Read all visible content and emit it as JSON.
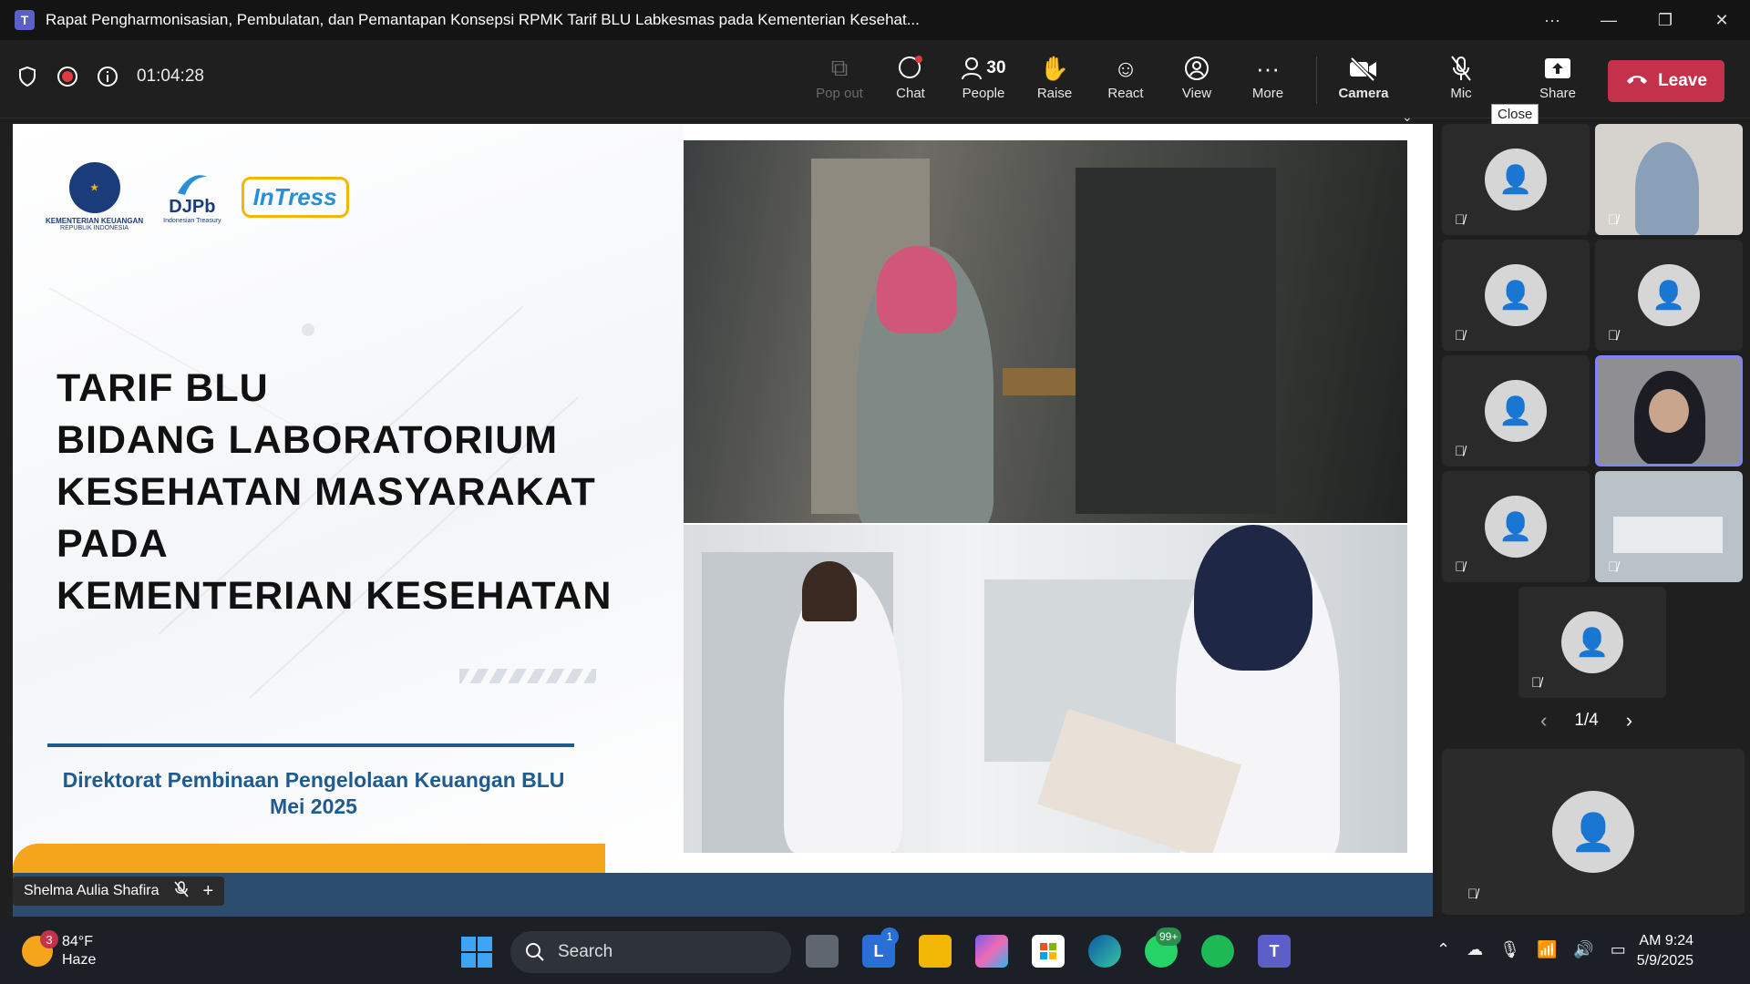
{
  "window": {
    "title": "Rapat Pengharmonisasian, Pembulatan, dan Pemantapan Konsepsi RPMK Tarif BLU Labkesmas pada Kementerian Kesehat...",
    "controls": [
      "···",
      "—",
      "❐",
      "✕"
    ]
  },
  "meeting": {
    "elapsed": "01:04:28"
  },
  "toolbar": {
    "popout": "Pop out",
    "chat": "Chat",
    "people": "People",
    "people_count": "30",
    "raise": "Raise",
    "react": "React",
    "view": "View",
    "more": "More",
    "camera": "Camera",
    "mic": "Mic",
    "share": "Share",
    "leave": "Leave",
    "tooltip": "Close"
  },
  "slide": {
    "logos": {
      "kemenkeu": "KEMENTERIAN KEUANGAN",
      "kemenkeu_sub": "REPUBLIK INDONESIA",
      "djpb": "DJPb",
      "djpb_sub": "Indonesian Treasury",
      "intress": "InTress"
    },
    "title_lines": [
      "TARIF BLU",
      "BIDANG LABORATORIUM",
      "KESEHATAN MASYARAKAT",
      "PADA",
      "KEMENTERIAN KESEHATAN"
    ],
    "footer_line1": "Direktorat Pembinaan Pengelolaan Keuangan BLU",
    "footer_line2": "Mei 2025"
  },
  "presenter": {
    "name": "Shelma Aulia Shafira"
  },
  "gallery": {
    "pager": "1/4"
  },
  "taskbar": {
    "weather_temp": "84°F",
    "weather_cond": "Haze",
    "weather_badge": "3",
    "search_placeholder": "Search",
    "badge_l": "1",
    "badge_whatsapp": "99+",
    "time": "9:24 AM",
    "date": "5/9/2025"
  },
  "colors": {
    "leave": "#c4314b",
    "accent": "#7f85f5",
    "slide_blue": "#1f5b8e",
    "slide_yellow": "#f4a51c"
  }
}
